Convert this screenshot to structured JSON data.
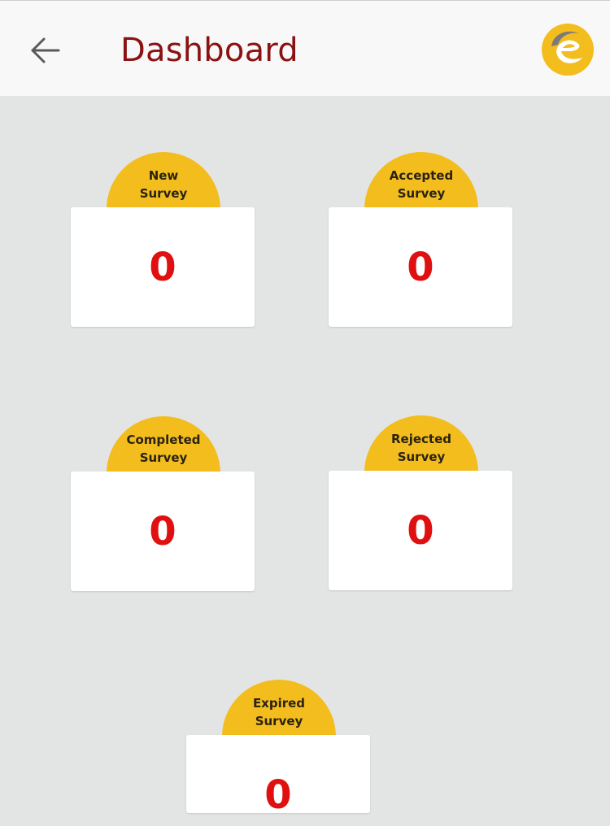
{
  "header": {
    "title": "Dashboard",
    "back_icon": "arrow-left-icon",
    "logo_icon": "brand-logo-icon",
    "title_color": "#8a1212"
  },
  "accent_color": "#f3bd1e",
  "count_color": "#e01010",
  "cards": [
    {
      "label_line1": "New",
      "label_line2": "Survey",
      "count": "0"
    },
    {
      "label_line1": "Accepted",
      "label_line2": "Survey",
      "count": "0"
    },
    {
      "label_line1": "Completed",
      "label_line2": "Survey",
      "count": "0"
    },
    {
      "label_line1": "Rejected",
      "label_line2": "Survey",
      "count": "0"
    },
    {
      "label_line1": "Expired",
      "label_line2": "Survey",
      "count": "0"
    }
  ]
}
